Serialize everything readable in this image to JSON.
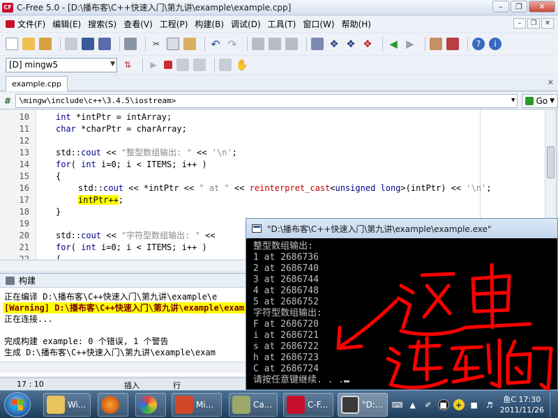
{
  "window": {
    "title": "C-Free 5.0 - [D:\\播布客\\C++快速入门\\第九讲\\example\\example.cpp]",
    "app_icon_text": "CF"
  },
  "menu": [
    "文件(F)",
    "编辑(E)",
    "搜索(S)",
    "查看(V)",
    "工程(P)",
    "构建(B)",
    "调试(D)",
    "工具(T)",
    "窗口(W)",
    "帮助(H)"
  ],
  "toolbar": {
    "compiler": "[D] mingw5",
    "go_label": "Go"
  },
  "file_tab": "example.cpp",
  "include_path": "\\mingw\\include\\c++\\3.4.5\\iostream>",
  "code": [
    {
      "ln": "10",
      "indent": 1,
      "parts": [
        {
          "t": "int",
          "c": "kw"
        },
        {
          "t": " *intPtr = intArray;"
        }
      ]
    },
    {
      "ln": "11",
      "indent": 1,
      "parts": [
        {
          "t": "char",
          "c": "kw"
        },
        {
          "t": " *charPtr = charArray;"
        }
      ]
    },
    {
      "ln": "12",
      "indent": 0,
      "parts": []
    },
    {
      "ln": "13",
      "indent": 1,
      "parts": [
        {
          "t": "std::"
        },
        {
          "t": "cout",
          "c": "kw"
        },
        {
          "t": " << "
        },
        {
          "t": "\"整型数组输出: \"",
          "c": "str"
        },
        {
          "t": " << "
        },
        {
          "t": "'\\n'",
          "c": "str"
        },
        {
          "t": ";"
        }
      ]
    },
    {
      "ln": "14",
      "indent": 1,
      "parts": [
        {
          "t": "for",
          "c": "kw"
        },
        {
          "t": "( "
        },
        {
          "t": "int",
          "c": "kw"
        },
        {
          "t": " i=0; i < ITEMS; i++ )"
        }
      ]
    },
    {
      "ln": "15",
      "indent": 1,
      "parts": [
        {
          "t": "{"
        }
      ]
    },
    {
      "ln": "16",
      "indent": 2,
      "parts": [
        {
          "t": "std::"
        },
        {
          "t": "cout",
          "c": "kw"
        },
        {
          "t": " << *intPtr << "
        },
        {
          "t": "\" at \"",
          "c": "str"
        },
        {
          "t": " << "
        },
        {
          "t": "reinterpret_cast",
          "c": "cast"
        },
        {
          "t": "<"
        },
        {
          "t": "unsigned long",
          "c": "kw"
        },
        {
          "t": ">(intPtr) << "
        },
        {
          "t": "'\\n'",
          "c": "str"
        },
        {
          "t": ";"
        }
      ]
    },
    {
      "ln": "17",
      "indent": 2,
      "parts": [
        {
          "t": "intPtr++",
          "c": "hl"
        },
        {
          "t": ";"
        }
      ]
    },
    {
      "ln": "18",
      "indent": 1,
      "parts": [
        {
          "t": "}"
        }
      ]
    },
    {
      "ln": "19",
      "indent": 0,
      "parts": []
    },
    {
      "ln": "20",
      "indent": 1,
      "parts": [
        {
          "t": "std::"
        },
        {
          "t": "cout",
          "c": "kw"
        },
        {
          "t": " << "
        },
        {
          "t": "\"字符型数组输出: \"",
          "c": "str"
        },
        {
          "t": " <<"
        }
      ]
    },
    {
      "ln": "21",
      "indent": 1,
      "parts": [
        {
          "t": "for",
          "c": "kw"
        },
        {
          "t": "( "
        },
        {
          "t": "int",
          "c": "kw"
        },
        {
          "t": " i=0; i < ITEMS; i++ )"
        }
      ]
    },
    {
      "ln": "22",
      "indent": 1,
      "parts": [
        {
          "t": "{"
        }
      ]
    }
  ],
  "build": {
    "title": "构建",
    "lines": [
      "正在编译 D:\\播布客\\C++快速入门\\第九讲\\example\\e",
      "[Warning] D:\\播布客\\C++快速入门\\第九讲\\example\\exam",
      "正在连接...",
      "",
      "完成构建 example: 0 个错误, 1 个警告",
      "生成 D:\\播布客\\C++快速入门\\第九讲\\example\\exam"
    ]
  },
  "status": {
    "position": "17 : 10",
    "mode": "插入",
    "unit": "行"
  },
  "console": {
    "title": "\"D:\\播布客\\C++快速入门\\第九讲\\example\\example.exe\"",
    "lines": [
      "整型数组输出:",
      "1 at 2686736",
      "2 at 2686740",
      "3 at 2686744",
      "4 at 2686748",
      "5 at 2686752",
      "字符型数组输出:",
      "F at 2686720",
      "i at 2686721",
      "s at 2686722",
      "h at 2686723",
      "C at 2686724",
      "请按任意键继续. . ."
    ]
  },
  "annotation": {
    "color": "#ff0000"
  },
  "taskbar": {
    "tasks": [
      {
        "label": "Wi...",
        "color": "#e8c45a"
      },
      {
        "label": "",
        "color": "#e06a1a"
      },
      {
        "label": "",
        "color": "#4aa84a"
      },
      {
        "label": "Mi...",
        "color": "#d24726"
      },
      {
        "label": "Ca...",
        "color": "#9aa86a"
      },
      {
        "label": "C-F...",
        "color": "#c8102e"
      },
      {
        "label": "\"D:...",
        "color": "#3a3a3a"
      }
    ],
    "ime": "鱼C",
    "time": "17:30",
    "date": "2011/11/26"
  }
}
